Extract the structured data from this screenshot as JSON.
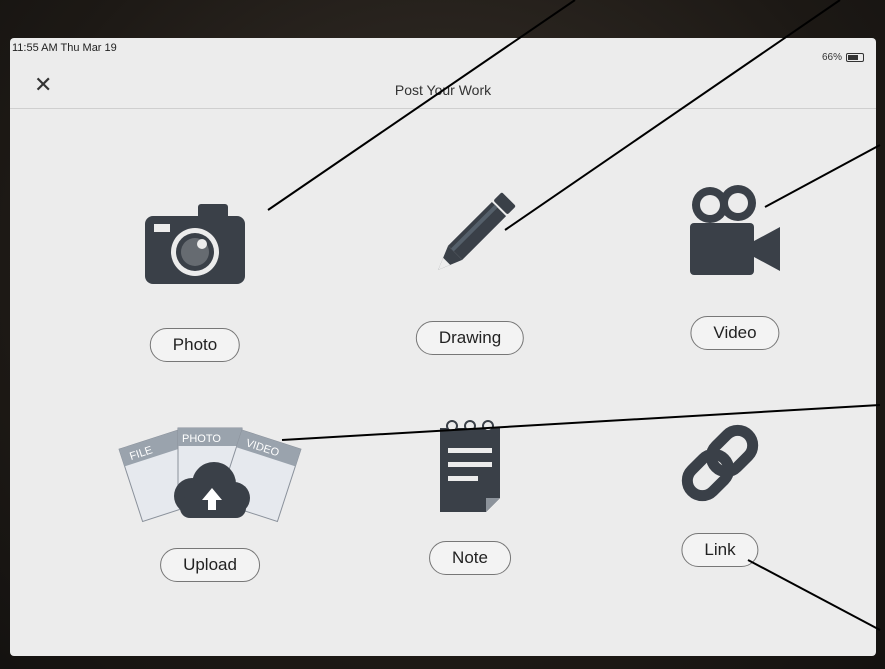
{
  "status_bar": {
    "time": "11:55 AM  Thu Mar 19",
    "battery": "66%"
  },
  "header": {
    "title": "Post Your Work",
    "close_symbol": "✕"
  },
  "options": [
    {
      "label": "Photo",
      "icon": "camera-icon"
    },
    {
      "label": "Drawing",
      "icon": "pencil-icon"
    },
    {
      "label": "Video",
      "icon": "video-camera-icon"
    },
    {
      "label": "Upload",
      "icon": "cloud-upload-icon",
      "card_labels": [
        "FILE",
        "PHOTO",
        "VIDEO"
      ]
    },
    {
      "label": "Note",
      "icon": "notepad-icon"
    },
    {
      "label": "Link",
      "icon": "chain-link-icon"
    }
  ],
  "colors": {
    "icon": "#3a4048",
    "screen_bg": "#ececec",
    "annotation_line": "#000000"
  }
}
